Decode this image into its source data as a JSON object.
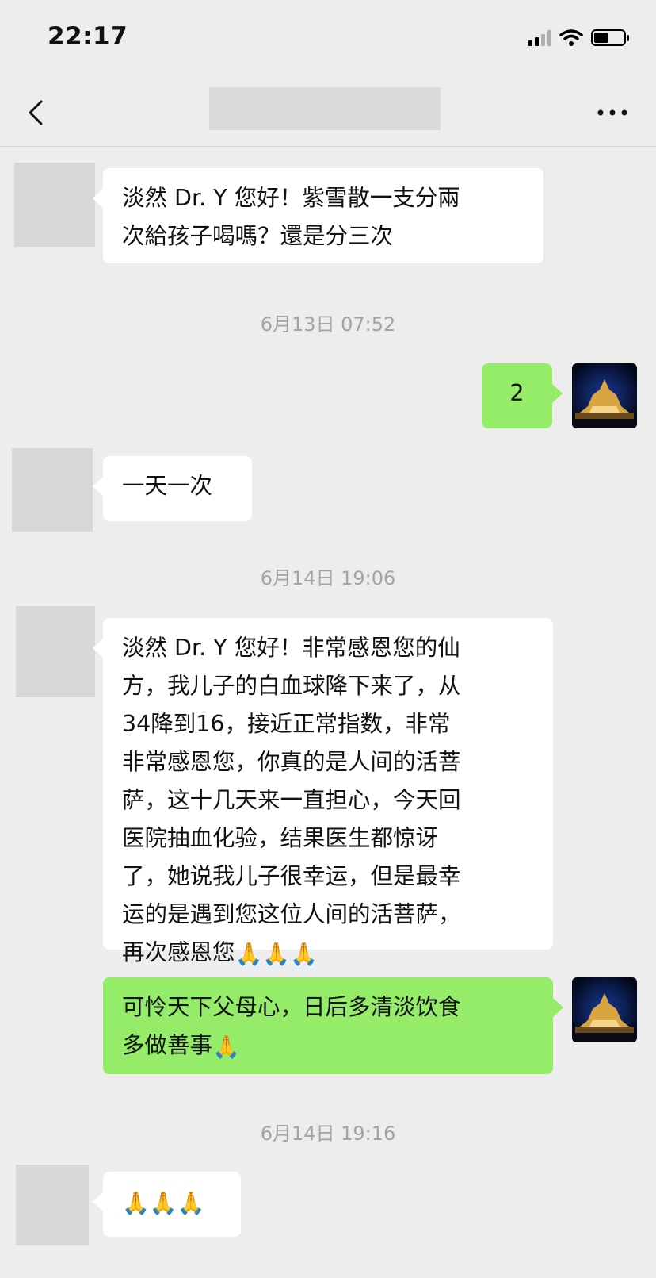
{
  "status_bar": {
    "time": "22:17",
    "battery_level": 0.5
  },
  "nav": {
    "title": "",
    "back_icon": "chevron-left-icon",
    "more_icon": "more-dots-icon"
  },
  "messages": [
    {
      "side": "in",
      "lines": [
        "淡然 Dr. Y 您好！紫雪散一支分兩",
        "次給孩子喝嗎？還是分三次"
      ]
    },
    {
      "timestamp": "6月13日 07:52"
    },
    {
      "side": "out",
      "lines": [
        "2"
      ]
    },
    {
      "side": "in",
      "lines": [
        "一天一次"
      ]
    },
    {
      "timestamp": "6月14日 19:06"
    },
    {
      "side": "in",
      "lines": [
        "淡然 Dr. Y 您好！非常感恩您的仙",
        "方，我儿子的白血球降下来了，从",
        "34降到16，接近正常指数，非常",
        "非常感恩您，你真的是人间的活菩",
        "萨，这十几天来一直担心，今天回",
        "医院抽血化验，结果医生都惊讶",
        "了，她说我儿子很幸运，但是最幸",
        "运的是遇到您这位人间的活菩萨，",
        "再次感恩您"
      ],
      "emoji": "🙏🙏🙏"
    },
    {
      "side": "out",
      "lines": [
        "可怜天下父母心，日后多清淡饮食",
        "多做善事"
      ],
      "emoji": "🙏"
    },
    {
      "timestamp": "6月14日 19:16"
    },
    {
      "side": "in",
      "lines": [],
      "emoji": "🙏🙏🙏"
    }
  ],
  "colors": {
    "background": "#ededed",
    "incoming_bubble": "#ffffff",
    "outgoing_bubble": "#95ec69",
    "timestamp": "#a3a3a3"
  }
}
